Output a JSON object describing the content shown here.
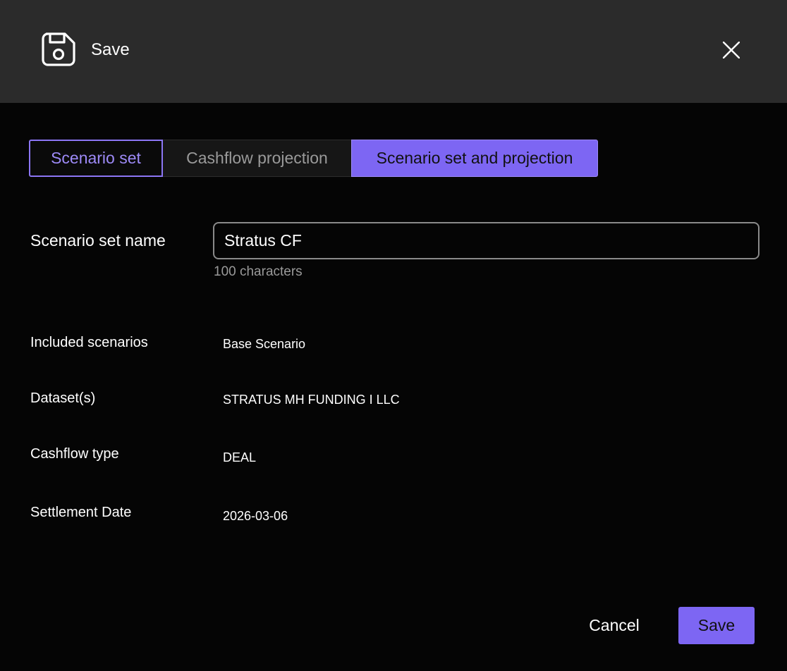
{
  "header": {
    "title": "Save",
    "icon": "save-icon",
    "close_icon": "close-icon"
  },
  "tabs": [
    {
      "label": "Scenario set",
      "state": "outlined"
    },
    {
      "label": "Cashflow projection",
      "state": "inactive"
    },
    {
      "label": "Scenario set and projection",
      "state": "selected"
    }
  ],
  "form": {
    "name_label": "Scenario set name",
    "name_value": "Stratus CF",
    "name_hint": "100 characters"
  },
  "details": [
    {
      "label": "Included scenarios",
      "value": "Base Scenario"
    },
    {
      "label": "Dataset(s)",
      "value": "STRATUS MH FUNDING I LLC"
    },
    {
      "label": "Cashflow type",
      "value": "DEAL"
    },
    {
      "label": "Settlement Date",
      "value": "2026-03-06"
    }
  ],
  "footer": {
    "cancel_label": "Cancel",
    "save_label": "Save"
  },
  "colors": {
    "accent": "#7d66f3",
    "accent_text": "#9d8af7",
    "header_bg": "#2b2b2b",
    "body_bg": "#050505"
  }
}
